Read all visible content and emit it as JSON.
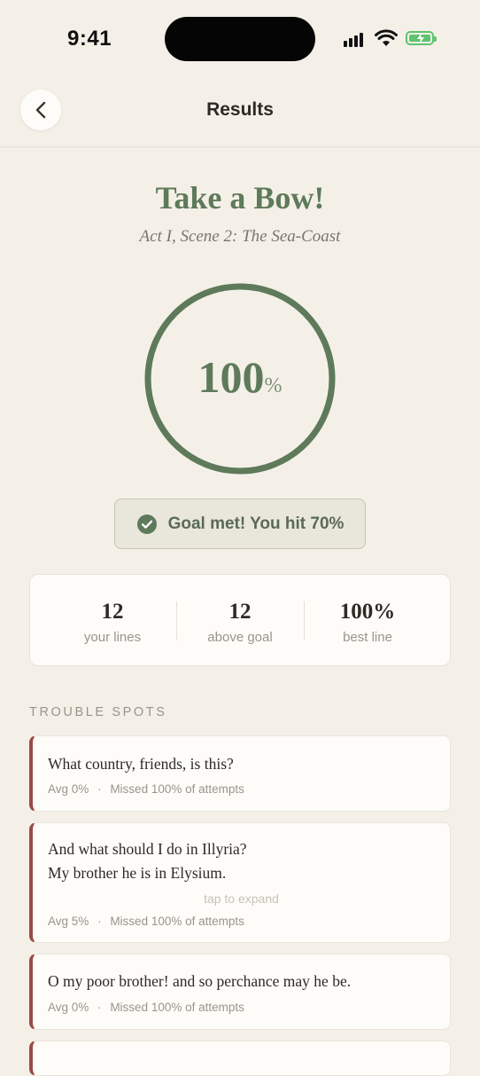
{
  "status": {
    "time": "9:41"
  },
  "nav": {
    "title": "Results"
  },
  "result": {
    "headline": "Take a Bow!",
    "scene": "Act I, Scene 2: The Sea-Coast",
    "score": "100",
    "score_unit": "%",
    "score_fraction": 1.0,
    "goal_text": "Goal met! You hit 70%"
  },
  "stats": [
    {
      "value": "12",
      "label": "your lines"
    },
    {
      "value": "12",
      "label": "above goal"
    },
    {
      "value": "100%",
      "label": "best line"
    }
  ],
  "trouble": {
    "title": "TROUBLE SPOTS",
    "items": [
      {
        "lines": [
          "What country, friends, is this?"
        ],
        "avg": "Avg 0%",
        "sep": "·",
        "missed": "Missed 100% of attempts"
      },
      {
        "lines": [
          "And what should I do in Illyria?",
          "My brother he is in Elysium."
        ],
        "hint": "tap to expand",
        "avg": "Avg 5%",
        "sep": "·",
        "missed": "Missed 100% of attempts"
      },
      {
        "lines": [
          "O my poor brother! and so perchance may he be."
        ],
        "avg": "Avg 0%",
        "sep": "·",
        "missed": "Missed 100% of attempts"
      }
    ]
  },
  "colors": {
    "accent_green": "#5e7a5a",
    "trouble_red": "#9b4a42",
    "background": "#f4f0e8"
  }
}
